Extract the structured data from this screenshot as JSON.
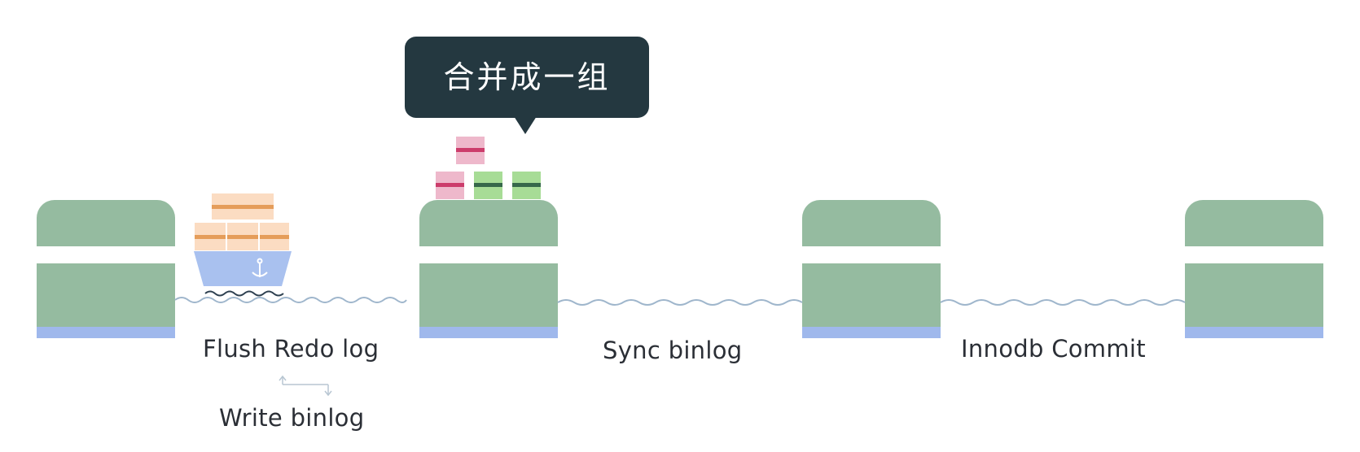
{
  "bubble": {
    "text": "合并成一组"
  },
  "stages": [
    {
      "label": "Flush Redo log"
    },
    {
      "label": "Write binlog"
    },
    {
      "label": "Sync binlog"
    },
    {
      "label": "Innodb Commit"
    }
  ],
  "colors": {
    "pier": "#95bba0",
    "pier_stripe": "#9fb8ec",
    "bubble": "#243840",
    "ship_hull": "#a9c1ef",
    "container_orange_bg": "#fbdcc2",
    "container_orange_band": "#e59d5a",
    "container_pink_bg": "#eeb8cb",
    "container_pink_band": "#cc3c6b",
    "container_green_bg": "#a7dc96",
    "container_green_band": "#36684a",
    "water": "#9fb6cc"
  },
  "icons": [
    "ship-icon",
    "anchor-icon",
    "container-stack-icon",
    "arrow-swap-icon",
    "wave-line"
  ]
}
